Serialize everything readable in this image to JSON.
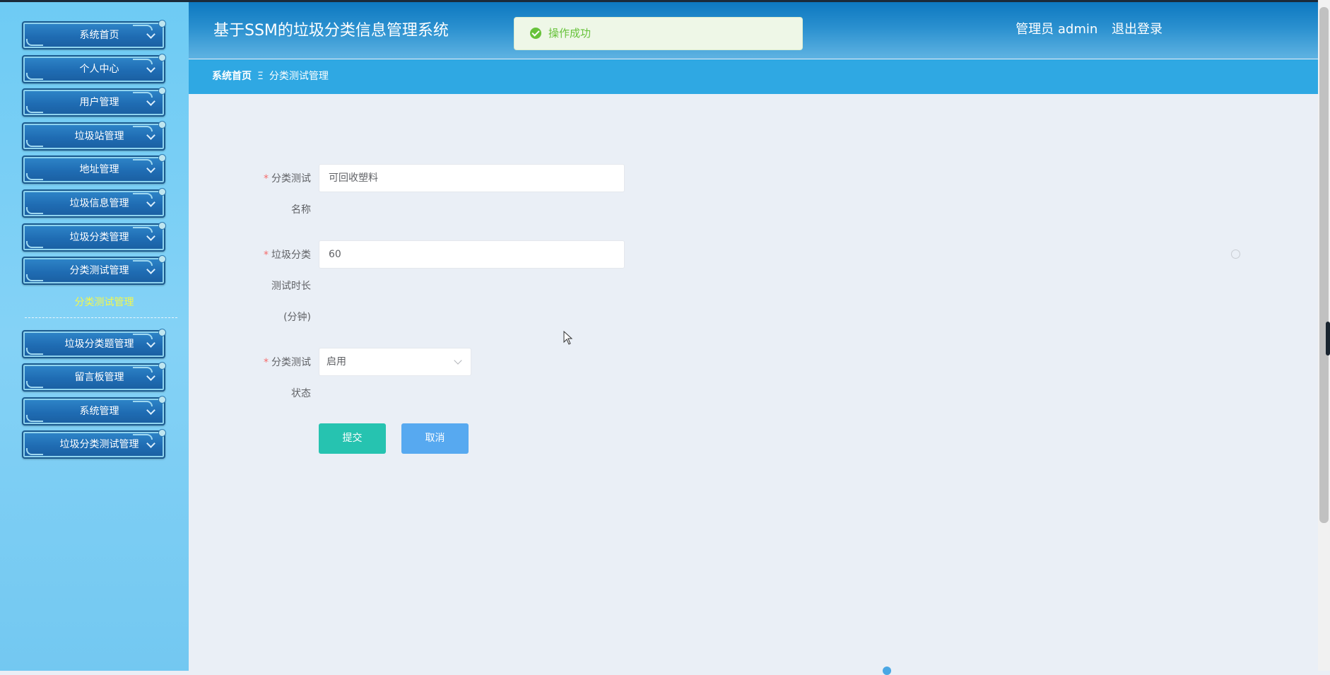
{
  "app": {
    "title": "基于SSM的垃圾分类信息管理系统",
    "user_role": "管理员 admin",
    "logout_label": "退出登录"
  },
  "toast": {
    "message": "操作成功",
    "type": "success"
  },
  "sidebar": {
    "items": [
      {
        "label": "系统首页"
      },
      {
        "label": "个人中心"
      },
      {
        "label": "用户管理"
      },
      {
        "label": "垃圾站管理"
      },
      {
        "label": "地址管理"
      },
      {
        "label": "垃圾信息管理"
      },
      {
        "label": "垃圾分类管理"
      },
      {
        "label": "分类测试管理"
      },
      {
        "label": "垃圾分类题管理"
      },
      {
        "label": "留言板管理"
      },
      {
        "label": "系统管理"
      },
      {
        "label": "垃圾分类测试管理"
      }
    ],
    "active_submenu": "分类测试管理"
  },
  "breadcrumb": {
    "home": "系统首页",
    "separator": "Ξ",
    "current": "分类测试管理"
  },
  "form": {
    "name_label_line1": "分类测试",
    "name_label_line2": "名称",
    "name_value": "可回收塑料",
    "duration_label_line1": "垃圾分类",
    "duration_label_line2": "测试时长",
    "duration_label_line3": "(分钟)",
    "duration_value": "60",
    "status_label_line1": "分类测试",
    "status_label_line2": "状态",
    "status_value": "启用",
    "submit_label": "提交",
    "cancel_label": "取消"
  },
  "colors": {
    "header_top": "#0d78c0",
    "breadcrumb_bg": "#2fa8e3",
    "submit_bg": "#26c3b0",
    "cancel_bg": "#57a9f0",
    "success": "#67c23a",
    "required": "#f56c6c",
    "submenu_active": "#f4f84a"
  }
}
